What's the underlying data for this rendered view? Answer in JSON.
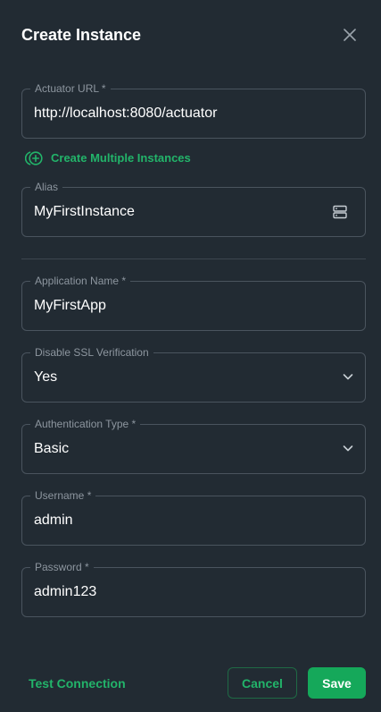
{
  "dialog": {
    "title": "Create Instance",
    "close_icon": "close-icon"
  },
  "fields": {
    "actuator_url": {
      "label": "Actuator URL *",
      "value": "http://localhost:8080/actuator"
    },
    "alias": {
      "label": "Alias",
      "value": "MyFirstInstance",
      "icon": "server-icon"
    },
    "application_name": {
      "label": "Application Name *",
      "value": "MyFirstApp"
    },
    "disable_ssl": {
      "label": "Disable SSL Verification",
      "value": "Yes",
      "icon": "chevron-down-icon"
    },
    "auth_type": {
      "label": "Authentication Type *",
      "value": "Basic",
      "icon": "chevron-down-icon"
    },
    "username": {
      "label": "Username *",
      "value": "admin"
    },
    "password": {
      "label": "Password *",
      "value": "admin123"
    }
  },
  "create_multiple": {
    "label": "Create Multiple Instances",
    "icon": "add-multiple-icon"
  },
  "footer": {
    "test_connection_label": "Test Connection",
    "cancel_label": "Cancel",
    "save_label": "Save"
  },
  "colors": {
    "background": "#222b33",
    "accent": "#22b46a",
    "save_button": "#15a85a",
    "border": "#4a545e",
    "label": "#8d969f"
  }
}
